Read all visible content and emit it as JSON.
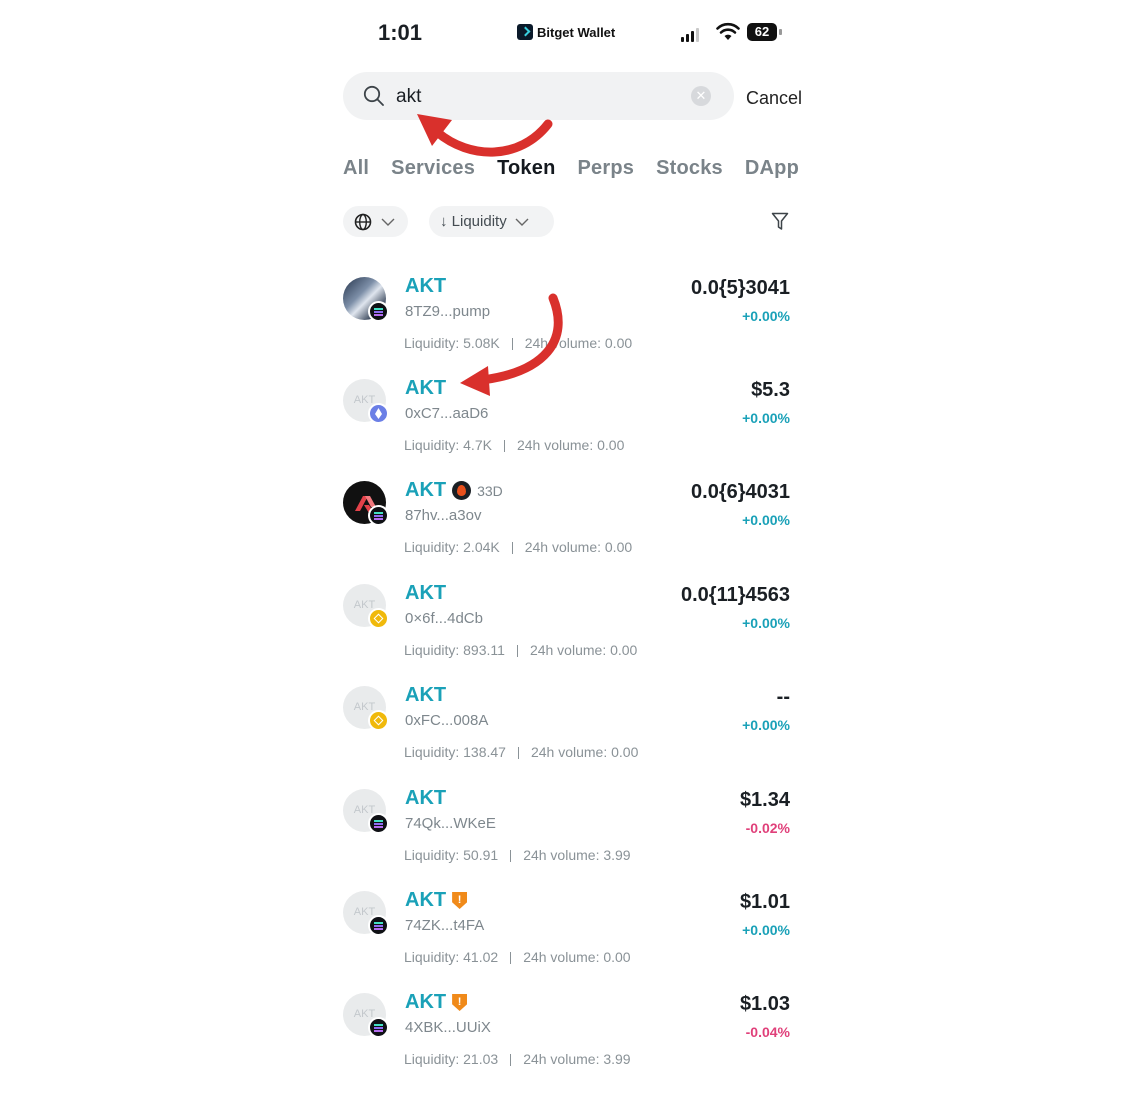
{
  "status_bar": {
    "time": "1:01",
    "app_name": "Bitget Wallet",
    "battery": "62"
  },
  "search": {
    "value": "akt",
    "placeholder": "",
    "cancel_label": "Cancel"
  },
  "tabs": [
    {
      "label": "All",
      "active": false
    },
    {
      "label": "Services",
      "active": false
    },
    {
      "label": "Token",
      "active": true
    },
    {
      "label": "Perps",
      "active": false
    },
    {
      "label": "Stocks",
      "active": false
    },
    {
      "label": "DApp",
      "active": false
    }
  ],
  "filters": {
    "network_icon": "globe-icon",
    "sort_label": "↓ Liquidity",
    "filter_icon": "funnel-icon"
  },
  "tokens": [
    {
      "symbol": "AKT",
      "address": "8TZ9...pump",
      "liquidity_label": "Liquidity: 5.08K",
      "volume_label": "24h volume: 0.00",
      "price": "0.0{5}3041",
      "change": "+0.00%",
      "direction": "up",
      "chain": "solana",
      "avatar": "photo"
    },
    {
      "symbol": "AKT",
      "address": "0xC7...aaD6",
      "liquidity_label": "Liquidity: 4.7K",
      "volume_label": "24h volume: 0.00",
      "price": "$5.3",
      "change": "+0.00%",
      "direction": "up",
      "chain": "ethereum",
      "avatar": "placeholder",
      "avatar_text": "AKT"
    },
    {
      "symbol": "AKT",
      "address": "87hv...a3ov",
      "liquidity_label": "Liquidity: 2.04K",
      "volume_label": "24h volume: 0.00",
      "price": "0.0{6}4031",
      "change": "+0.00%",
      "direction": "up",
      "chain": "solana",
      "avatar": "logo",
      "badge": "flame-icon",
      "age": "33D"
    },
    {
      "symbol": "AKT",
      "address": "0×6f...4dCb",
      "liquidity_label": "Liquidity: 893.11",
      "volume_label": "24h volume: 0.00",
      "price": "0.0{11}4563",
      "change": "+0.00%",
      "direction": "up",
      "chain": "bnb",
      "avatar": "placeholder",
      "avatar_text": "AKT"
    },
    {
      "symbol": "AKT",
      "address": "0xFC...008A",
      "liquidity_label": "Liquidity: 138.47",
      "volume_label": "24h volume: 0.00",
      "price": "--",
      "change": "+0.00%",
      "direction": "up",
      "chain": "bnb",
      "avatar": "placeholder",
      "avatar_text": "AKT"
    },
    {
      "symbol": "AKT",
      "address": "74Qk...WKeE",
      "liquidity_label": "Liquidity: 50.91",
      "volume_label": "24h volume: 3.99",
      "price": "$1.34",
      "change": "-0.02%",
      "direction": "down",
      "chain": "solana",
      "avatar": "placeholder",
      "avatar_text": "AKT"
    },
    {
      "symbol": "AKT",
      "address": "74ZK...t4FA",
      "liquidity_label": "Liquidity: 41.02",
      "volume_label": "24h volume: 0.00",
      "price": "$1.01",
      "change": "+0.00%",
      "direction": "up",
      "chain": "solana",
      "avatar": "placeholder",
      "avatar_text": "AKT",
      "badge": "shield-warning-icon",
      "badge_text": "!"
    },
    {
      "symbol": "AKT",
      "address": "4XBK...UUiX",
      "liquidity_label": "Liquidity: 21.03",
      "volume_label": "24h volume: 3.99",
      "price": "$1.03",
      "change": "-0.04%",
      "direction": "down",
      "chain": "solana",
      "avatar": "placeholder",
      "avatar_text": "AKT",
      "badge": "shield-warning-icon",
      "badge_text": "!"
    }
  ],
  "colors": {
    "accent": "#1aa1b8",
    "negative": "#e0407a",
    "annotation_arrow": "#d9302c"
  }
}
